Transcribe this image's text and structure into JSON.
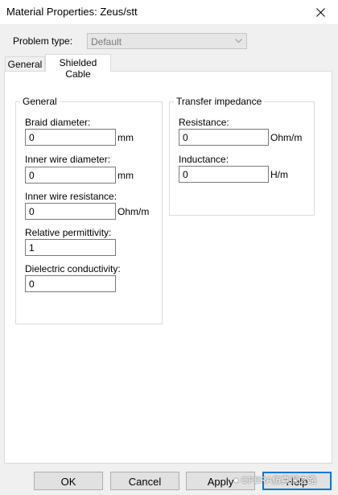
{
  "window": {
    "title": "Material Properties: Zeus/stt"
  },
  "problem_type": {
    "label": "Problem type:",
    "value": "Default"
  },
  "tabs": [
    {
      "label": "General"
    },
    {
      "label": "Shielded Cable"
    }
  ],
  "general_group": {
    "title": "General",
    "braid_diameter": {
      "label": "Braid diameter:",
      "value": "0",
      "unit": "mm"
    },
    "inner_wire_diameter": {
      "label": "Inner wire diameter:",
      "value": "0",
      "unit": "mm"
    },
    "inner_wire_resistance": {
      "label": "Inner wire resistance:",
      "value": "0",
      "unit": "Ohm/m"
    },
    "relative_permittivity": {
      "label": "Relative permittivity:",
      "value": "1"
    },
    "dielectric_conductivity": {
      "label": "Dielectric conductivity:",
      "value": "0"
    }
  },
  "transfer_group": {
    "title": "Transfer impedance",
    "resistance": {
      "label": "Resistance:",
      "value": "0",
      "unit": "Ohm/m"
    },
    "inductance": {
      "label": "Inductance:",
      "value": "0",
      "unit": "H/m"
    }
  },
  "buttons": {
    "ok": "OK",
    "cancel": "Cancel",
    "apply": "Apply",
    "help": "Help"
  },
  "watermark": "OPERA仿真深之路"
}
